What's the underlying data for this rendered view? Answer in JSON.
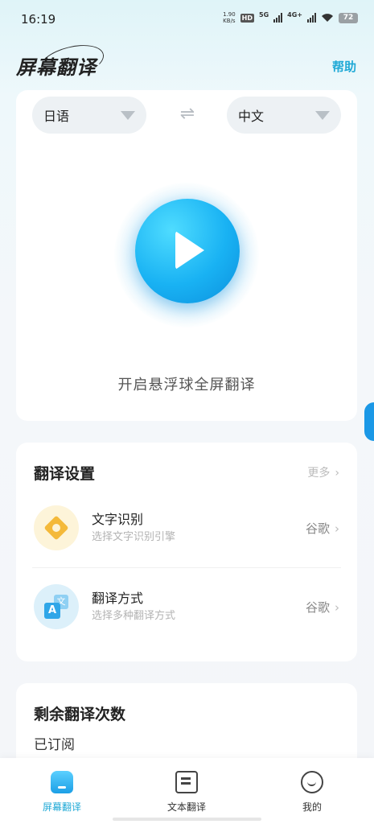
{
  "status_bar": {
    "time": "16:19",
    "speed_value": "1.90",
    "speed_unit": "KB/s",
    "hd_label": "HD",
    "net_5g": "5G",
    "net_4g": "4G+",
    "battery": "72",
    "icons": [
      "hd-icon",
      "signal-icon",
      "wifi-icon",
      "battery-icon"
    ]
  },
  "header": {
    "app_title": "屏幕翻译",
    "help_label": "帮助"
  },
  "main": {
    "source_language": "日语",
    "target_language": "中文",
    "swap_icon": "⇌",
    "start_label": "开启悬浮球全屏翻译"
  },
  "settings": {
    "title": "翻译设置",
    "more_label": "更多",
    "rows": [
      {
        "title": "文字识别",
        "subtitle": "选择文字识别引擎",
        "value": "谷歌",
        "icon": "ocr-icon"
      },
      {
        "title": "翻译方式",
        "subtitle": "选择多种翻译方式",
        "value": "谷歌",
        "icon": "translate-mode-icon"
      }
    ],
    "mode_icon_a": "A",
    "mode_icon_b": "文"
  },
  "quota": {
    "title": "剩余翻译次数",
    "status": "已订阅"
  },
  "bottom_nav": {
    "items": [
      {
        "label": "屏幕翻译",
        "icon": "screen-translate-icon",
        "active": true
      },
      {
        "label": "文本翻译",
        "icon": "text-translate-icon",
        "active": false
      },
      {
        "label": "我的",
        "icon": "profile-icon",
        "active": false
      }
    ]
  },
  "colors": {
    "accent": "#1fa9d6",
    "play_button": "#19b2f3",
    "ocr_icon": "#f4b93a",
    "mode_icon": "#2fa6e8"
  }
}
